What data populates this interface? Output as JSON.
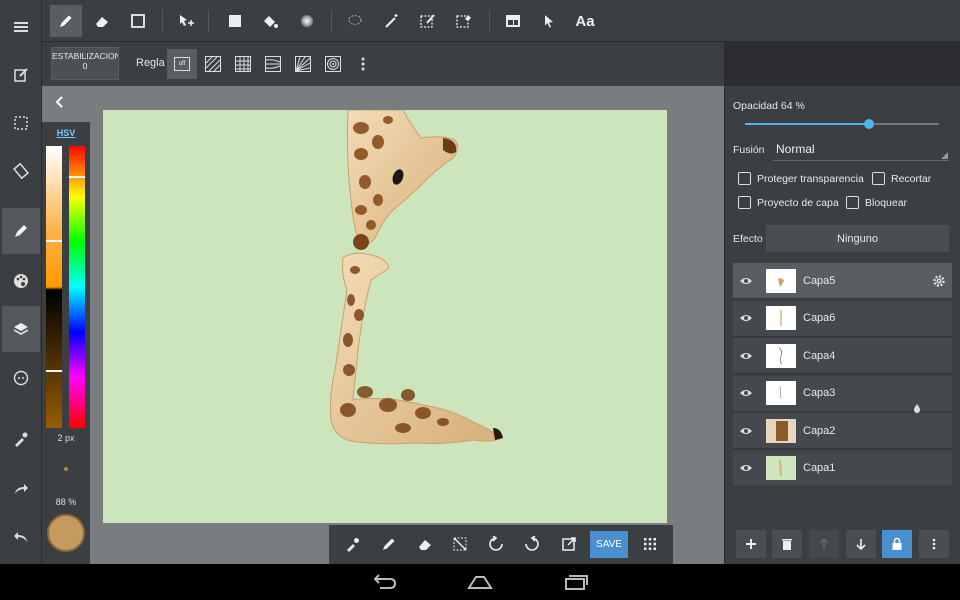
{
  "toolbar": {
    "font_label": "Aa",
    "icons": [
      "pen-icon",
      "eraser-icon",
      "rectangle-outline-icon",
      "move-icon",
      "fill-rect-icon",
      "bucket-icon",
      "gradient-icon",
      "lasso-icon",
      "magic-wand-icon",
      "select-pen-icon",
      "select-eraser-icon",
      "frame-icon",
      "pointer-icon",
      "text-icon"
    ]
  },
  "subbar": {
    "stabilizer_label": "ESTABILIZACION 0",
    "ruler_label": "Regla",
    "ruler_off_label": "off"
  },
  "color_panel": {
    "mode_label": "HSV",
    "brush_size": "2 px",
    "brush_opacity": "88 %",
    "current_color": "#c59a5e"
  },
  "float_toolbar": {
    "save_label": "SAVE"
  },
  "layer_panel": {
    "opacity_label": "Opacidad 64 %",
    "opacity_value": 0.64,
    "blend_label": "Fusión",
    "blend_value": "Normal",
    "checkbox_protect": "Proteger transparencia",
    "checkbox_clip": "Recortar",
    "checkbox_draft": "Proyecto de capa",
    "checkbox_lock": "Bloquear",
    "effect_label": "Efecto",
    "effect_value": "Ninguno",
    "layers": [
      {
        "name": "Capa5",
        "selected": true
      },
      {
        "name": "Capa6",
        "selected": false
      },
      {
        "name": "Capa4",
        "selected": false
      },
      {
        "name": "Capa3",
        "selected": false
      },
      {
        "name": "Capa2",
        "selected": false
      },
      {
        "name": "Capa1",
        "selected": false
      }
    ]
  },
  "colors": {
    "accent": "#4a8fcf",
    "canvas_bg": "#cde5bc"
  }
}
